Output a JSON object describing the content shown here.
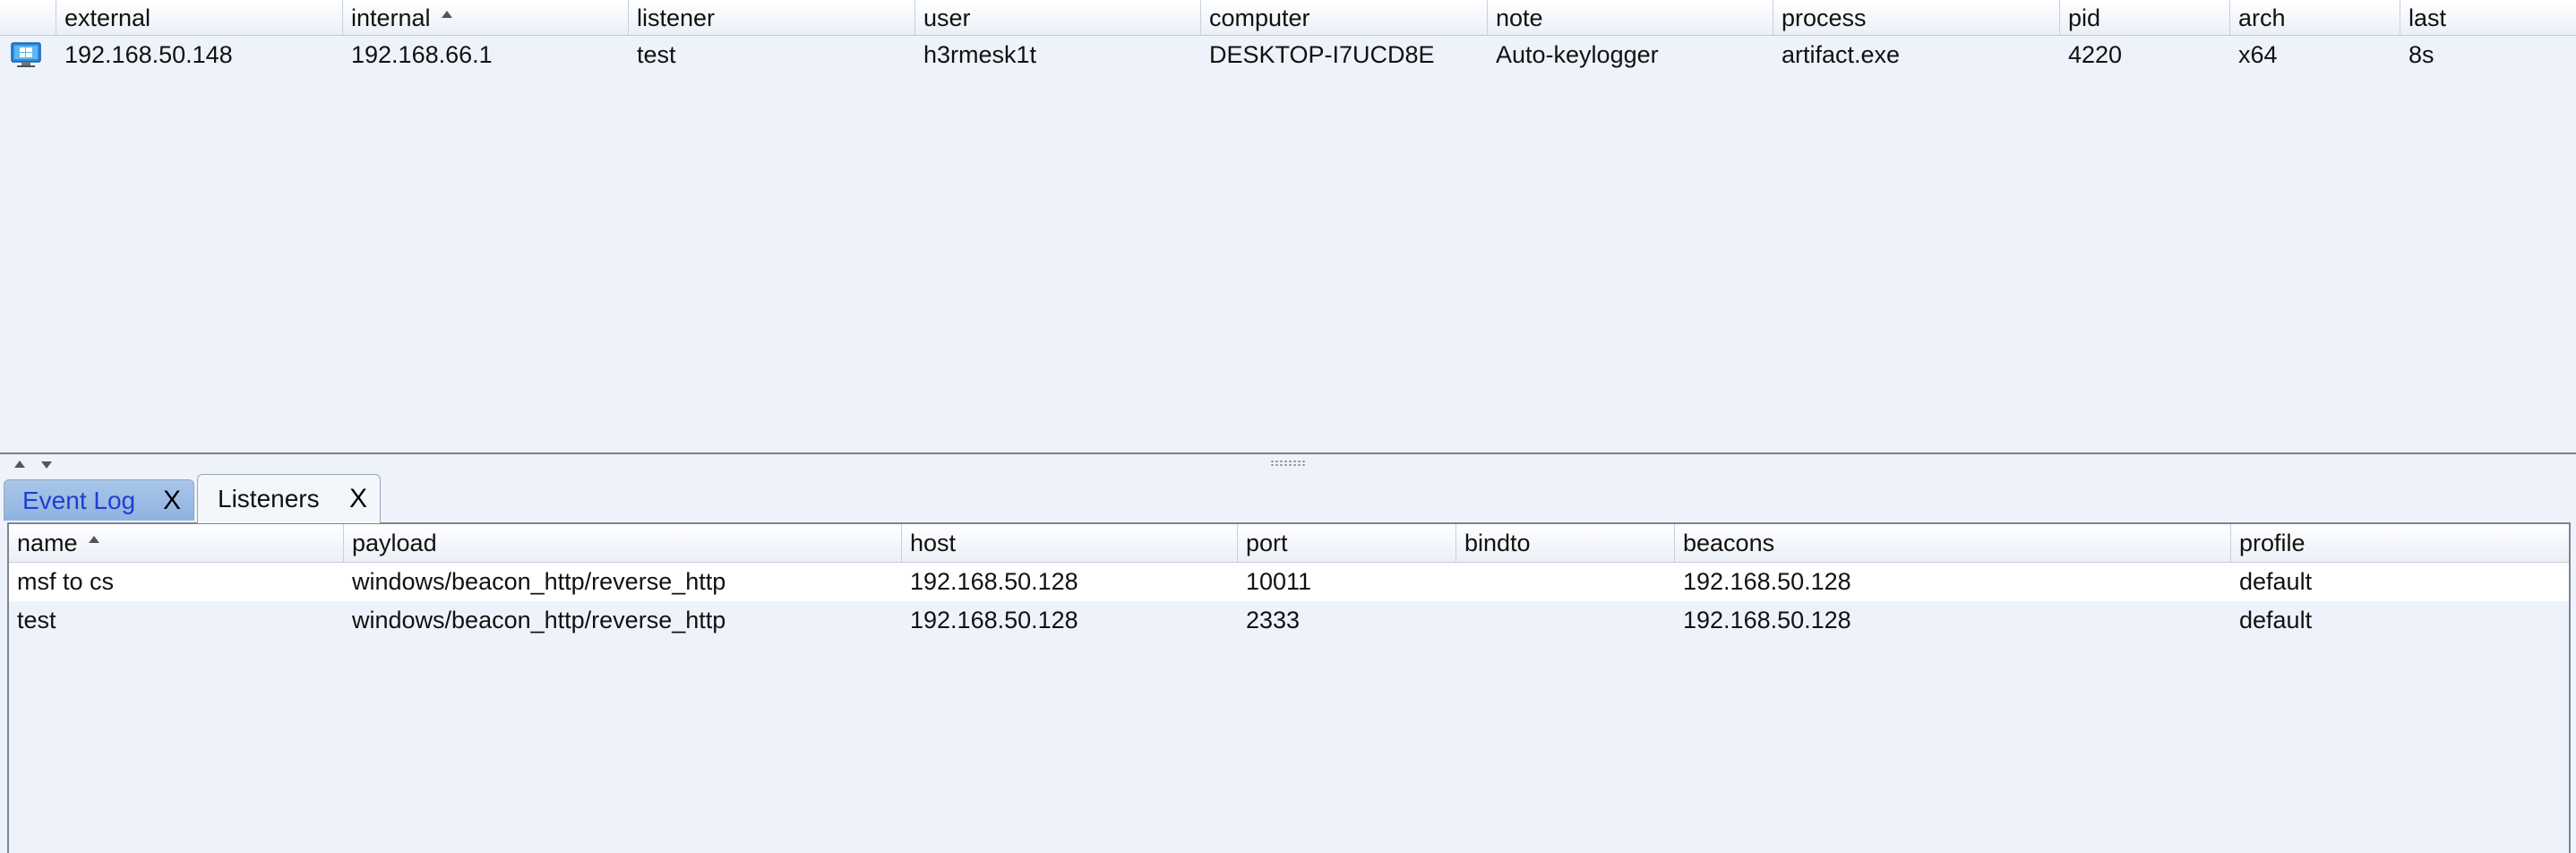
{
  "sessions": {
    "columns": [
      "external",
      "internal",
      "listener",
      "user",
      "computer",
      "note",
      "process",
      "pid",
      "arch",
      "last"
    ],
    "sorted_column": "internal",
    "rows": [
      {
        "icon": "windows-icon",
        "external": "192.168.50.148",
        "internal": "192.168.66.1",
        "listener": "test",
        "user": "h3rmesk1t",
        "computer": "DESKTOP-I7UCD8E",
        "note": "Auto-keylogger",
        "process": "artifact.exe",
        "pid": "4220",
        "arch": "x64",
        "last": "8s"
      }
    ]
  },
  "tabs": [
    {
      "label": "Event Log",
      "close": "X",
      "active": false
    },
    {
      "label": "Listeners",
      "close": "X",
      "active": true
    }
  ],
  "listeners": {
    "columns": [
      "name",
      "payload",
      "host",
      "port",
      "bindto",
      "beacons",
      "profile"
    ],
    "sorted_column": "name",
    "rows": [
      {
        "name": "msf to cs",
        "payload": "windows/beacon_http/reverse_http",
        "host": "192.168.50.128",
        "port": "10011",
        "bindto": "",
        "beacons": "192.168.50.128",
        "profile": "default"
      },
      {
        "name": "test",
        "payload": "windows/beacon_http/reverse_http",
        "host": "192.168.50.128",
        "port": "2333",
        "bindto": "",
        "beacons": "192.168.50.128",
        "profile": "default"
      }
    ]
  },
  "colors": {
    "background": "#eef3fb",
    "active_tab_text": "#1e3fd0",
    "windows_icon": "#2a8fe0"
  }
}
